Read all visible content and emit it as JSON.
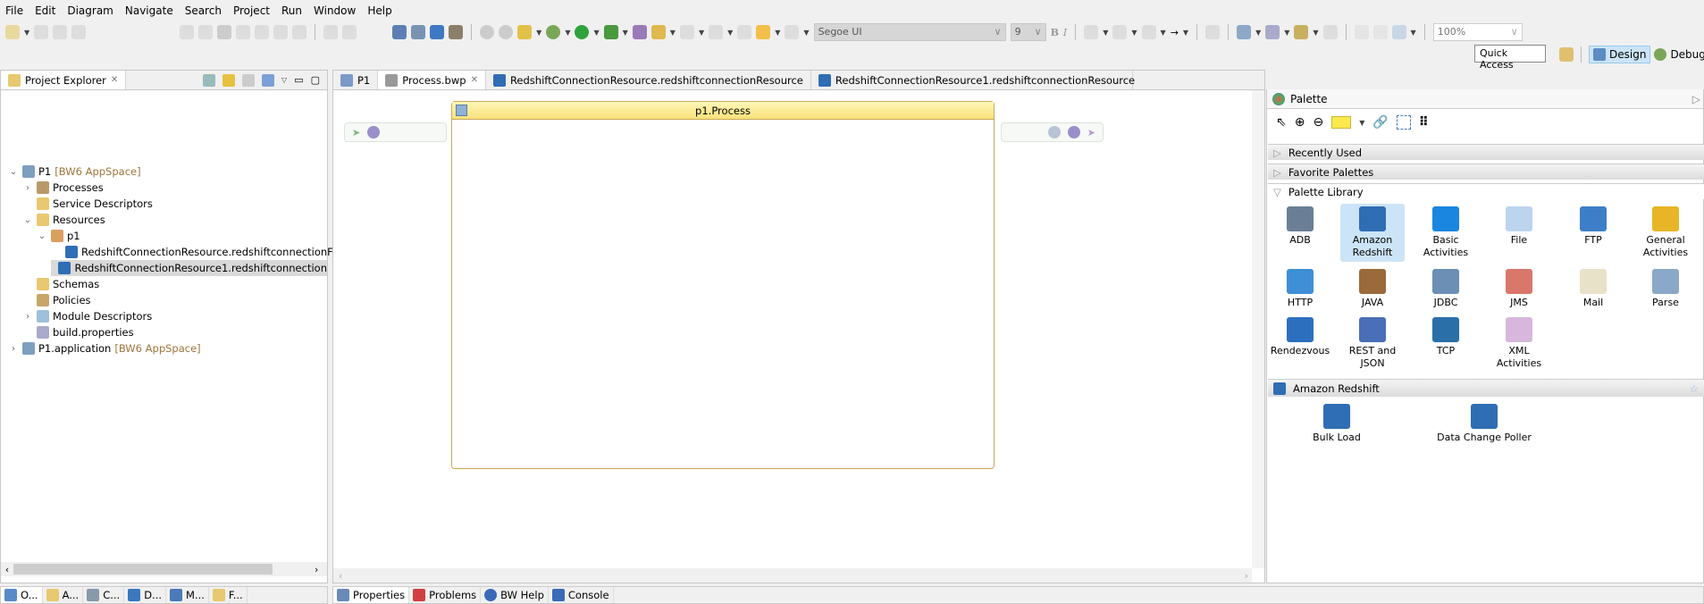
{
  "menu": [
    "File",
    "Edit",
    "Diagram",
    "Navigate",
    "Search",
    "Project",
    "Run",
    "Window",
    "Help"
  ],
  "toolbar": {
    "font": "Segoe UI",
    "size": "9",
    "bold": "B",
    "italic": "I",
    "zoom": "100%",
    "quick_access": "Quick Access",
    "design": "Design",
    "debug": "Debug"
  },
  "explorer": {
    "title": "Project Explorer",
    "tree": [
      {
        "label": "P1",
        "suffix": "[BW6 AppSpace]",
        "level": 0,
        "arrow": "v"
      },
      {
        "label": "Processes",
        "level": 1,
        "arrow": ">"
      },
      {
        "label": "Service Descriptors",
        "level": 1,
        "arrow": ""
      },
      {
        "label": "Resources",
        "level": 1,
        "arrow": "v"
      },
      {
        "label": "p1",
        "level": 2,
        "arrow": "v"
      },
      {
        "label": "RedshiftConnectionResource.redshiftconnectionF",
        "level": 3,
        "arrow": ""
      },
      {
        "label": "RedshiftConnectionResource1.redshiftconnection",
        "level": 3,
        "arrow": "",
        "selected": true
      },
      {
        "label": "Schemas",
        "level": 1,
        "arrow": ""
      },
      {
        "label": "Policies",
        "level": 1,
        "arrow": ""
      },
      {
        "label": "Module Descriptors",
        "level": 1,
        "arrow": ">"
      },
      {
        "label": "build.properties",
        "level": 1,
        "arrow": ""
      },
      {
        "label": "P1.application",
        "suffix": "[BW6 AppSpace]",
        "level": 0,
        "arrow": ">"
      }
    ]
  },
  "editor": {
    "tabs": [
      "P1",
      "Process.bwp",
      "RedshiftConnectionResource.redshiftconnectionResource",
      "RedshiftConnectionResource1.redshiftconnectionResource"
    ],
    "process_title": "p1.Process"
  },
  "palette": {
    "title": "Palette",
    "sections": [
      "Recently Used",
      "Favorite Palettes",
      "Palette Library"
    ],
    "library": [
      "ADB",
      "Amazon Redshift",
      "Basic Activities",
      "File",
      "FTP",
      "General Activities",
      "HTTP",
      "JAVA",
      "JDBC",
      "JMS",
      "Mail",
      "Parse",
      "Rendezvous",
      "REST and JSON",
      "TCP",
      "XML Activities"
    ],
    "library_colors": [
      "#6a7f95",
      "#2f6db5",
      "#1a86e0",
      "#bcd4ee",
      "#3d7ec9",
      "#e7b526",
      "#3f8fd6",
      "#9a6a3a",
      "#6b8fb5",
      "#d9776a",
      "#e8e2c9",
      "#8aa8c8",
      "#2c6fbf",
      "#4a6fb8",
      "#2b6fa8",
      "#d7b7dc"
    ],
    "selected_group": "Amazon Redshift",
    "group_items": [
      "Bulk Load",
      "Data Change Poller"
    ]
  },
  "bottom": {
    "left_tabs": [
      "O...",
      "A...",
      "C...",
      "D...",
      "M...",
      "F..."
    ],
    "right_tabs": [
      "Properties",
      "Problems",
      "BW Help",
      "Console"
    ]
  }
}
